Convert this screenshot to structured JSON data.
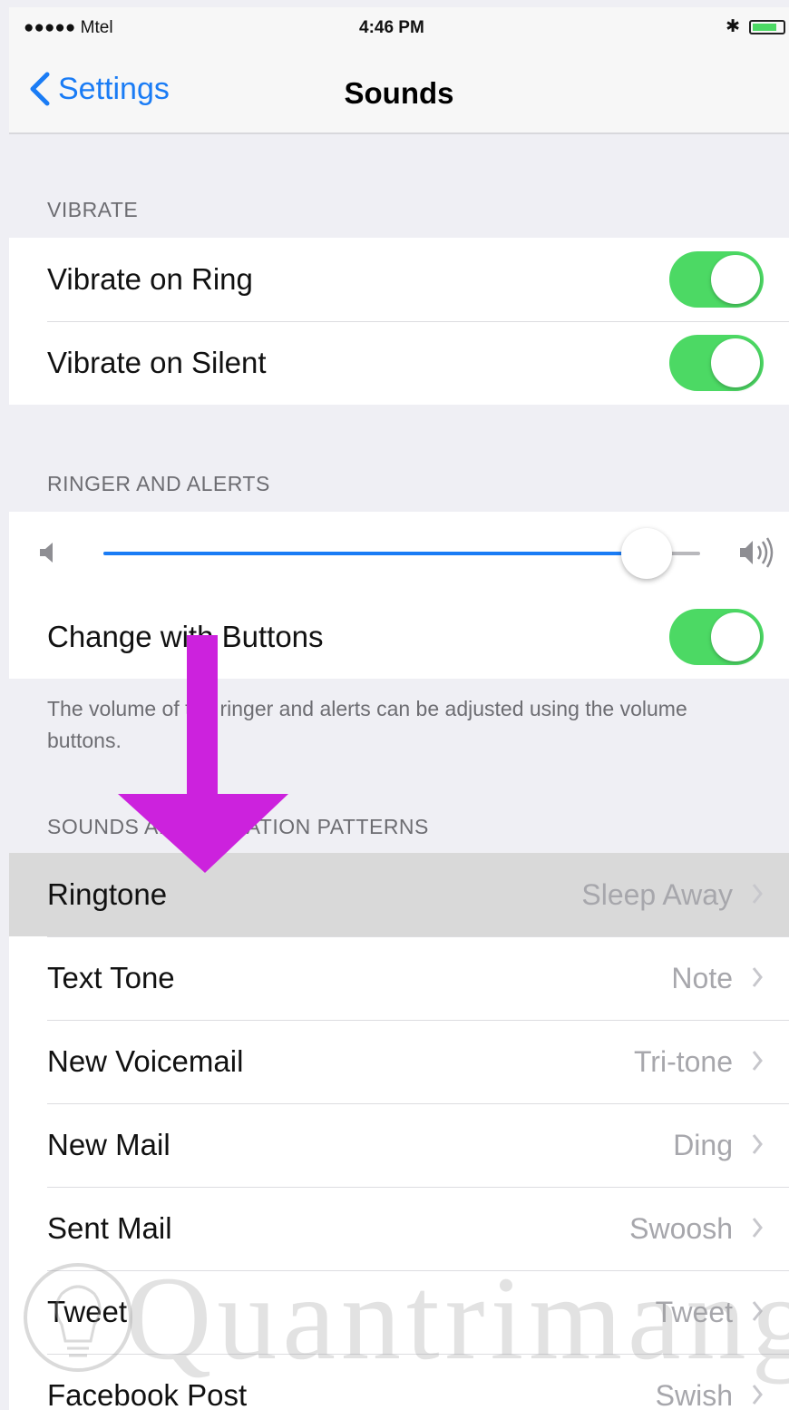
{
  "status_bar": {
    "carrier": "●●●●● Mtel",
    "time": "4:46 PM",
    "bluetooth": "✱"
  },
  "nav": {
    "back_label": "Settings",
    "title": "Sounds"
  },
  "vibrate": {
    "header": "VIBRATE",
    "rows": [
      {
        "label": "Vibrate on Ring",
        "on": true
      },
      {
        "label": "Vibrate on Silent",
        "on": true
      }
    ]
  },
  "ringer": {
    "header": "RINGER AND ALERTS",
    "volume_level": 0.91,
    "change_with_buttons_label": "Change with Buttons",
    "change_with_buttons_on": true,
    "footer": "The volume of the ringer and alerts can be adjusted using the volume buttons."
  },
  "sounds": {
    "header": "SOUNDS AND VIBRATION PATTERNS",
    "rows": [
      {
        "label": "Ringtone",
        "value": "Sleep Away",
        "highlighted": true
      },
      {
        "label": "Text Tone",
        "value": "Note"
      },
      {
        "label": "New Voicemail",
        "value": "Tri-tone"
      },
      {
        "label": "New Mail",
        "value": "Ding"
      },
      {
        "label": "Sent Mail",
        "value": "Swoosh"
      },
      {
        "label": "Tweet",
        "value": "Tweet"
      },
      {
        "label": "Facebook Post",
        "value": "Swish"
      }
    ]
  },
  "watermark": {
    "text": "Quantrimang"
  },
  "colors": {
    "accent": "#1a7cf5",
    "toggle_on": "#4cd964",
    "arrow": "#cc22dd",
    "section_text": "#6d6d72"
  },
  "icons": {
    "back": "chevron-left-icon",
    "row_disclosure": "chevron-right-icon",
    "volume_low": "speaker-low-icon",
    "volume_high": "speaker-high-icon",
    "annotation": "down-arrow-icon"
  }
}
